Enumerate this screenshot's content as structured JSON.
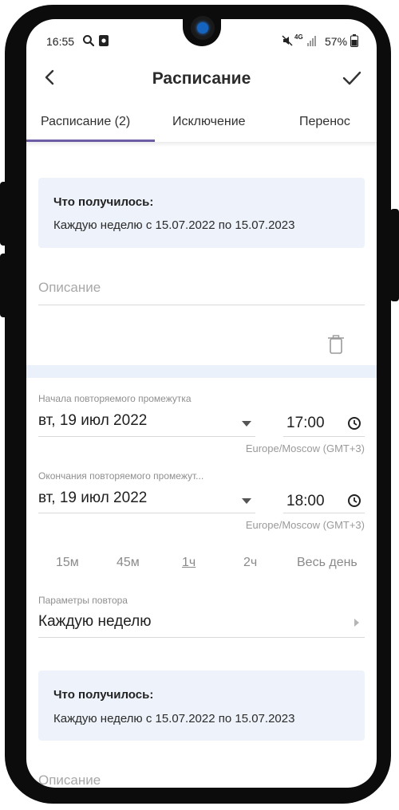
{
  "status_bar": {
    "time": "16:55",
    "network": "4G",
    "battery": "57%"
  },
  "header": {
    "title": "Расписание"
  },
  "tabs": [
    {
      "label": "Расписание (2)"
    },
    {
      "label": "Исключение"
    },
    {
      "label": "Перенос"
    }
  ],
  "result1": {
    "title": "Что получилось:",
    "text": "Каждую неделю с 15.07.2022 по 15.07.2023"
  },
  "description1": {
    "placeholder": "Описание"
  },
  "start": {
    "label": "Начала повторяемого промежутка",
    "date": "вт, 19 июл 2022",
    "time": "17:00",
    "timezone": "Europe/Moscow (GMT+3)"
  },
  "end": {
    "label": "Окончания повторяемого промежут...",
    "date": "вт, 19 июл 2022",
    "time": "18:00",
    "timezone": "Europe/Moscow (GMT+3)"
  },
  "durations": [
    {
      "label": "15м"
    },
    {
      "label": "45м"
    },
    {
      "label": "1ч"
    },
    {
      "label": "2ч"
    },
    {
      "label": "Весь день"
    }
  ],
  "repeat": {
    "label": "Параметры повтора",
    "value": "Каждую неделю"
  },
  "result2": {
    "title": "Что получилось:",
    "text": "Каждую неделю с 15.07.2022 по 15.07.2023"
  },
  "description2": {
    "placeholder": "Описание"
  },
  "colors": {
    "accent": "#6b5ca5",
    "card_bg": "#eef3fb",
    "divider_bg": "#eaf1fb"
  },
  "icons": {
    "back": "chevron-left-icon",
    "confirm": "check-icon",
    "delete": "trash-icon",
    "time": "clock-icon",
    "dropdown": "caret-down-icon",
    "next": "caret-right-icon"
  }
}
